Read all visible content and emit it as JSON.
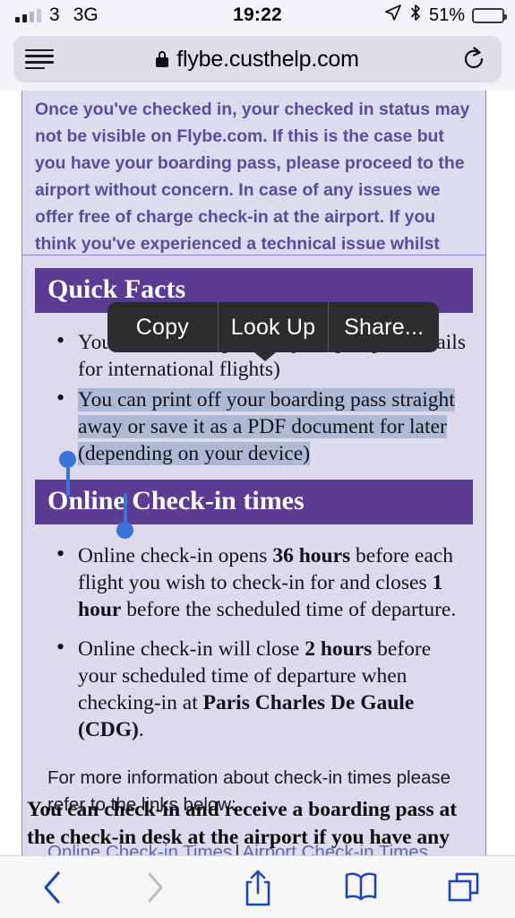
{
  "status_bar": {
    "carrier": "3",
    "network": "3G",
    "time": "19:22",
    "battery_percent": "51%",
    "battery_level": 51,
    "battery_color": "#FCCC33",
    "icons": [
      "signal-bars-icon",
      "location-arrow-icon",
      "bluetooth-icon",
      "battery-icon"
    ]
  },
  "browser": {
    "url": "flybe.custhelp.com",
    "lock_icon": "lock-icon",
    "reader_icon": "reader-view-icon",
    "reload_icon": "reload-icon"
  },
  "page": {
    "notice": "Once you've checked in, your checked in status may not be visible on Flybe.com.  If this is the case but you have your boarding pass, please proceed to the airport without concern. In case of any issues we offer free of charge check-in at the airport.  If you think you've experienced a technical issue whilst checking-in please contact us and we will be happy to assist",
    "quick_facts": {
      "heading": "Quick Facts",
      "items": [
        "You will need to provide your passport details for international flights)",
        "You can print off your boarding pass straight away or save it as a PDF document for later (depending on your device)"
      ]
    },
    "checkin_times": {
      "heading": "Online Check-in times",
      "bullet_1": {
        "part_1": "Online check-in opens ",
        "bold_1": "36 hours",
        "part_2": " before each flight you wish to check-in for and closes ",
        "bold_2": "1 hour",
        "part_3": " before the scheduled time of departure."
      },
      "bullet_2": {
        "part_1": "Online check-in will close ",
        "bold_1": "2 hours",
        "part_2": " before your scheduled time of departure when checking-in at ",
        "bold_2": "Paris Charles De Gaule (CDG)",
        "part_3": "."
      },
      "footer_text": "For more information about check-in times please refer to the links below:",
      "link_1": "Online Check-in Times",
      "link_separator": "|",
      "link_2": "Airport Check-in Times",
      "link_color": "#5B6BA8"
    },
    "tail_paragraph": "You can check-in and receive a boarding pass at the check-in desk at the airport if you have any difficulties with online check-in. Flybe does not charge for check-in. More information",
    "accent_color": "#5C3B93",
    "panel_background": "#DCDAEC",
    "notice_text_color": "#5A4E9C"
  },
  "selection": {
    "selected_text": "You can print off your boarding pass straight away or save it as a PDF document for later (depending on your device)",
    "highlight_color": "#AEB9D6",
    "handle_color": "#3B74D8"
  },
  "callout_menu": {
    "items": [
      "Copy",
      "Look Up",
      "Share..."
    ],
    "background": "#2C2C2E"
  },
  "toolbar": {
    "back": "back-icon",
    "forward": "forward-icon",
    "share": "share-icon",
    "bookmarks": "bookmarks-icon",
    "tabs": "tabs-icon"
  }
}
